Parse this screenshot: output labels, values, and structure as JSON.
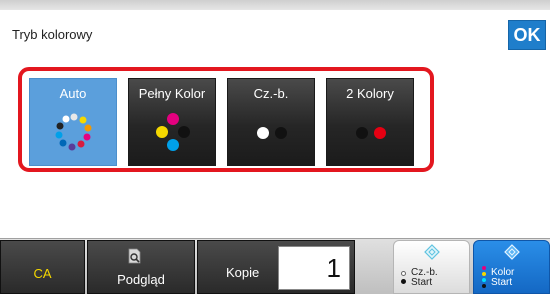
{
  "screen": {
    "title": "Tryb kolorowy",
    "ok_label": "OK"
  },
  "modes": [
    {
      "label": "Auto",
      "selected": true,
      "icon": "auto-color-icon"
    },
    {
      "label": "Pełny Kolor",
      "selected": false,
      "icon": "full-color-icon"
    },
    {
      "label": "Cz.-b.",
      "selected": false,
      "icon": "black-white-icon"
    },
    {
      "label": "2 Kolory",
      "selected": false,
      "icon": "two-color-icon"
    }
  ],
  "bottom_bar": {
    "ca_label": "CA",
    "preview_label": "Podgląd",
    "copies_label": "Kopie",
    "copies_value": "1",
    "start_bw_line1": "Cz.-b.",
    "start_bw_line2": "Start",
    "start_color_line1": "Kolor",
    "start_color_line2": "Start"
  },
  "colors": {
    "accent": "#1f7ecb",
    "selected_mode": "#5b9fdc",
    "group_border": "#e3171f",
    "ca_text": "#f5d800"
  }
}
